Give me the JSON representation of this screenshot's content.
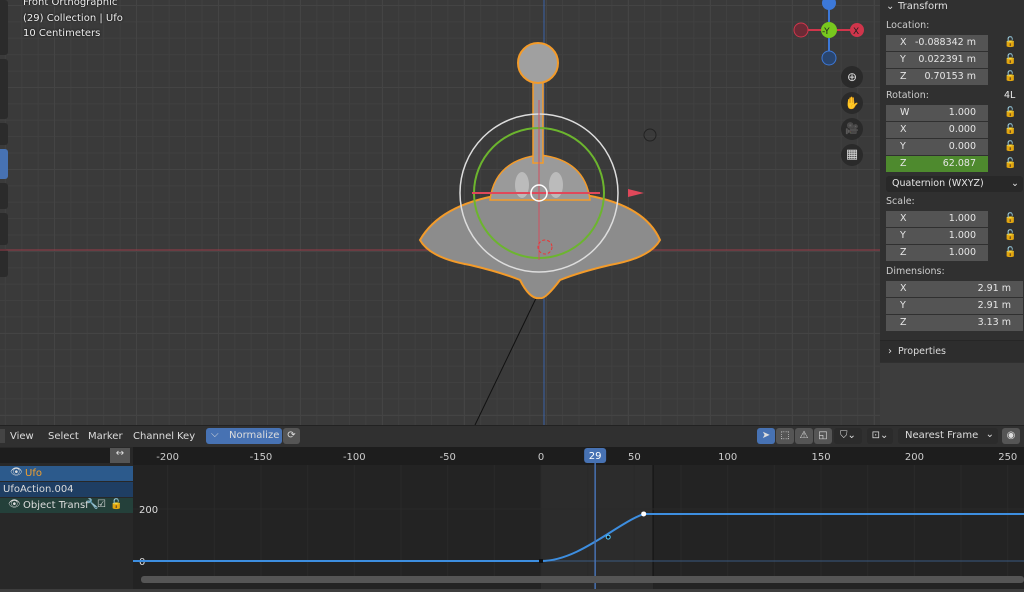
{
  "viewport": {
    "view_name": "Front Orthographic",
    "collection": "(29) Collection | Ufo",
    "scale": "10 Centimeters",
    "gizmo": {
      "z": "Z",
      "y": "-Y",
      "x": "X"
    },
    "nav_icons": [
      "zoom-icon",
      "hand-pan-icon",
      "camera-icon",
      "grid-icon"
    ]
  },
  "transform": {
    "title": "Transform",
    "location_label": "Location:",
    "location": [
      {
        "axis": "X",
        "value": "-0.088342 m"
      },
      {
        "axis": "Y",
        "value": "0.022391 m"
      },
      {
        "axis": "Z",
        "value": "0.70153 m"
      }
    ],
    "rotation_label": "Rotation:",
    "rotation_mode_badge": "4L",
    "rotation": [
      {
        "axis": "W",
        "value": "1.000"
      },
      {
        "axis": "X",
        "value": "0.000"
      },
      {
        "axis": "Y",
        "value": "0.000"
      },
      {
        "axis": "Z",
        "value": "62.087"
      }
    ],
    "rotation_mode": "Quaternion (WXYZ)",
    "scale_label": "Scale:",
    "scale": [
      {
        "axis": "X",
        "value": "1.000"
      },
      {
        "axis": "Y",
        "value": "1.000"
      },
      {
        "axis": "Z",
        "value": "1.000"
      }
    ],
    "dimensions_label": "Dimensions:",
    "dimensions": [
      {
        "axis": "X",
        "value": "2.91 m"
      },
      {
        "axis": "Y",
        "value": "2.91 m"
      },
      {
        "axis": "Z",
        "value": "3.13 m"
      }
    ],
    "properties_label": "Properties",
    "highlight_color": "#4e8a2e"
  },
  "graph_editor": {
    "menus": [
      "View",
      "Select",
      "Marker",
      "Channel",
      "Key"
    ],
    "normalize_label": "Normalize",
    "pivot": "Nearest Frame",
    "channels": [
      {
        "label": "Ufo",
        "type": "object"
      },
      {
        "label": "UfoAction.004",
        "type": "action"
      },
      {
        "label": "Object Transf",
        "type": "group"
      }
    ],
    "current_frame": "29",
    "accent": "#4772b3"
  },
  "chart_data": {
    "type": "line",
    "x_ticks": [
      -200,
      -150,
      -100,
      -50,
      0,
      50,
      100,
      150,
      200,
      250
    ],
    "y_ticks": [
      0,
      200
    ],
    "xlim": [
      -213,
      260
    ],
    "ylim": [
      -60,
      230
    ],
    "current_frame": 29,
    "scene_range": [
      0,
      60
    ],
    "keyframes": [
      {
        "frame": 0,
        "value": 0
      },
      {
        "frame": 55,
        "value": 181
      }
    ],
    "selected_handle": {
      "frame": 36,
      "value": 92
    },
    "series_color": "#3d8ee0"
  }
}
